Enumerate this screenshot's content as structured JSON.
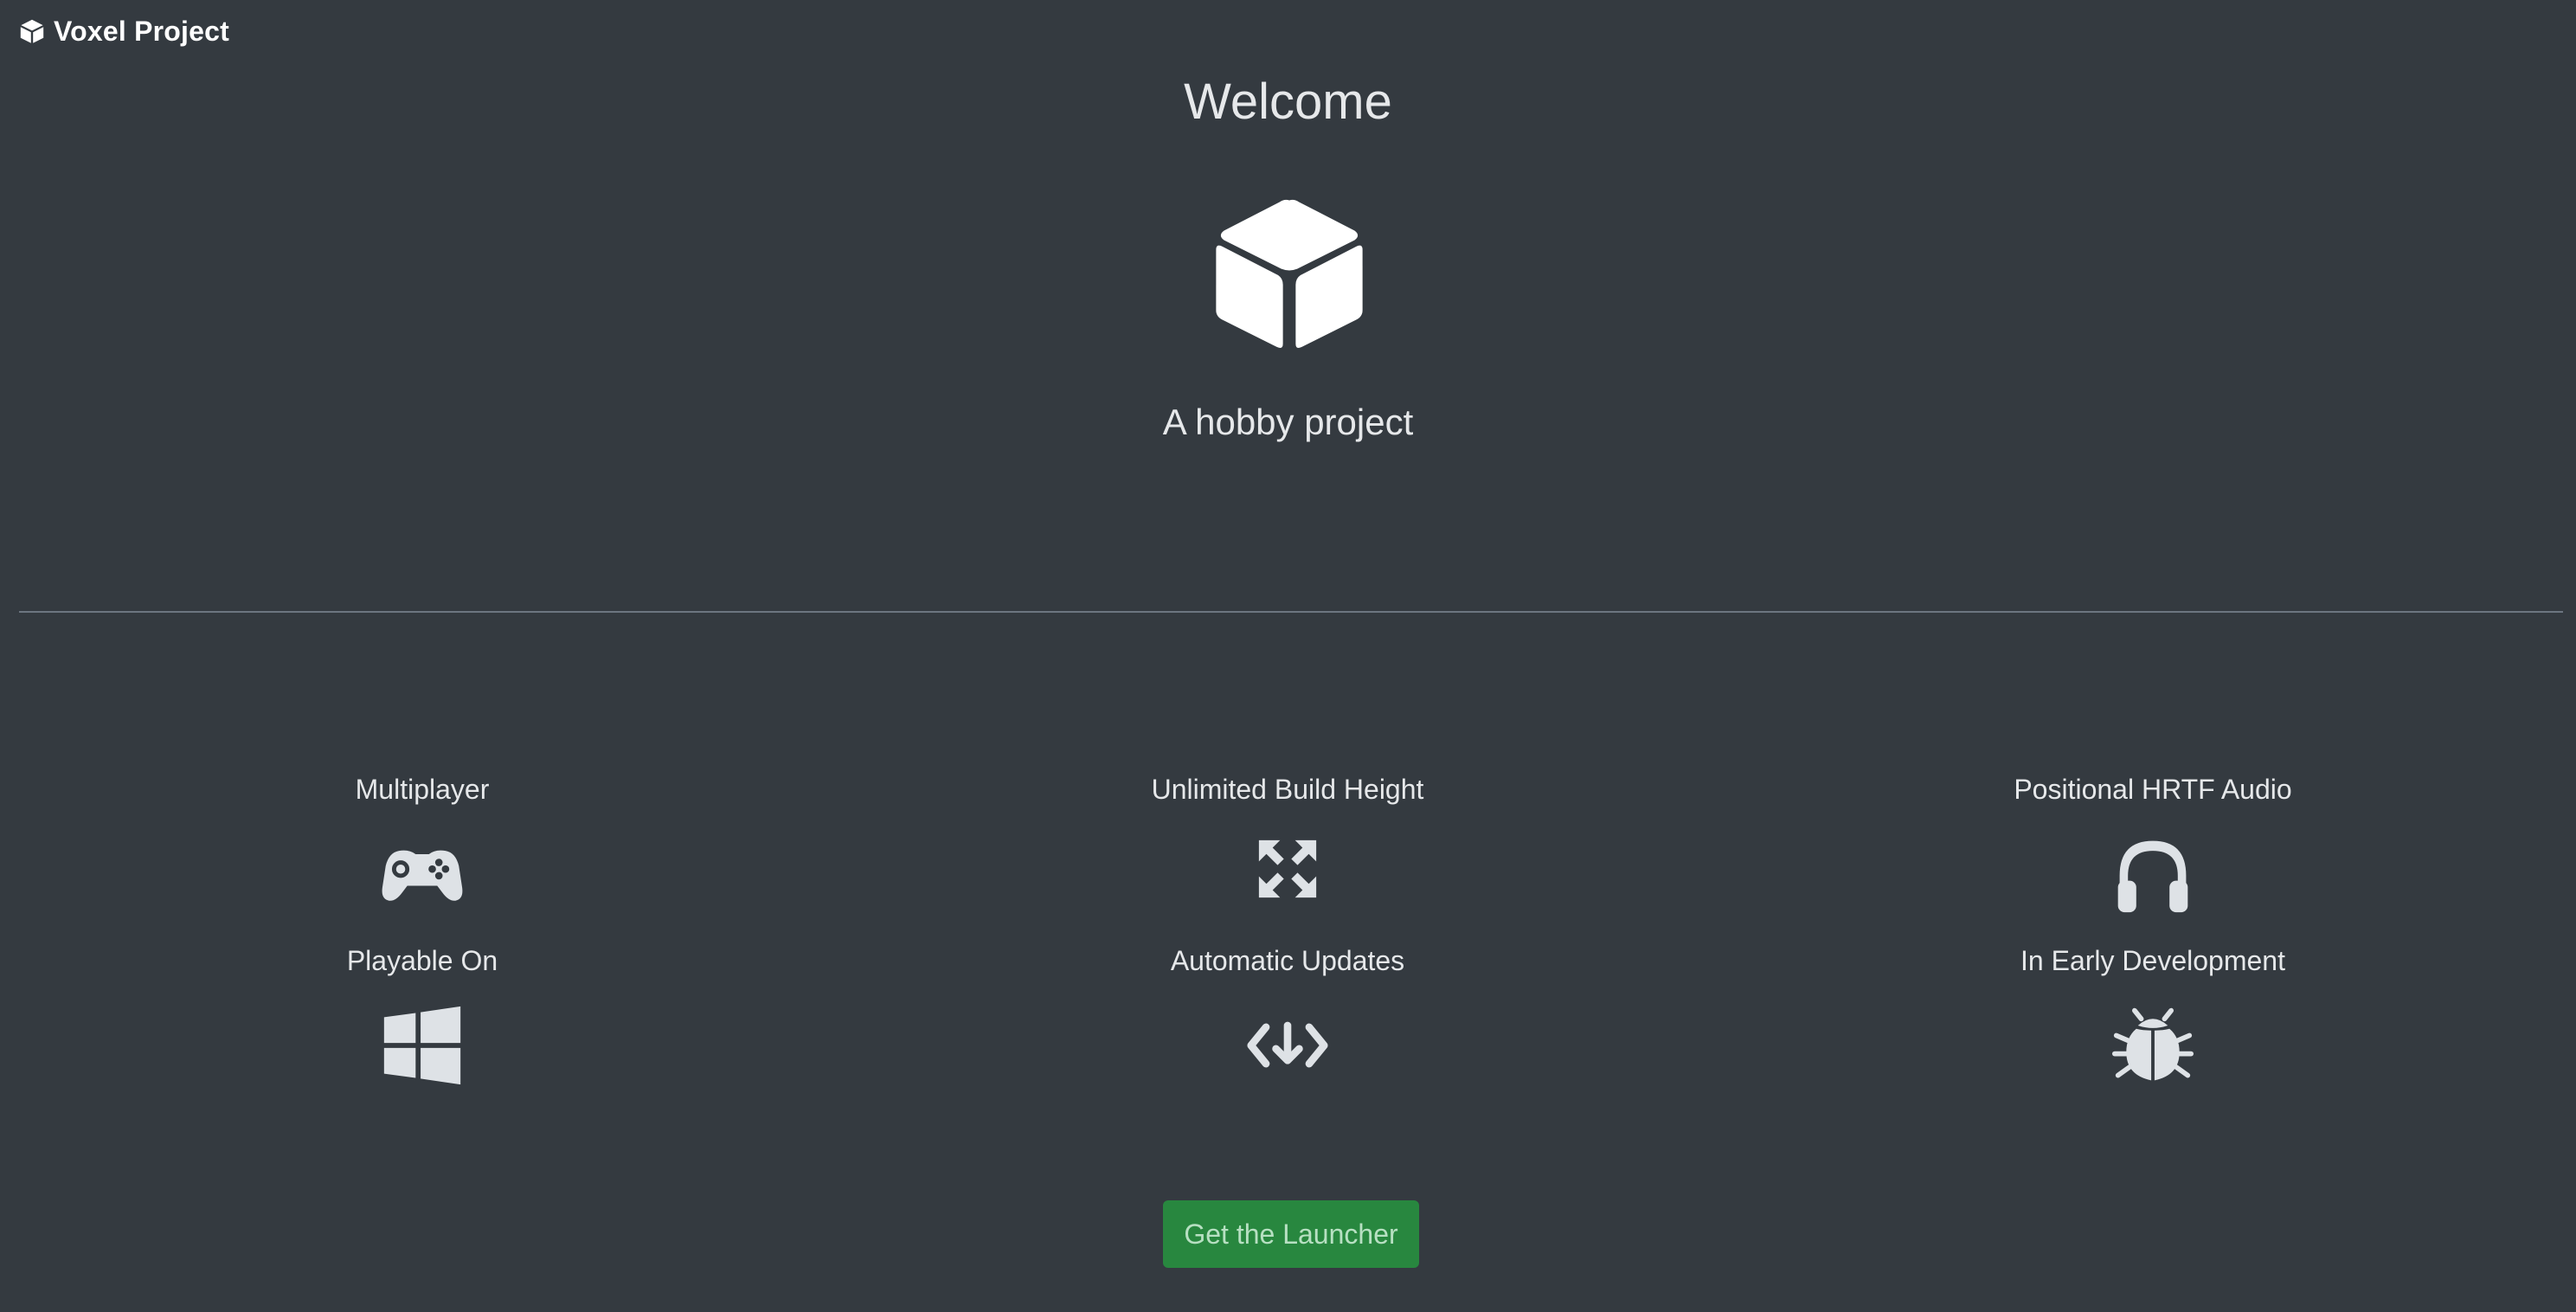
{
  "navbar": {
    "brand_label": "Voxel Project",
    "brand_icon": "cube-icon"
  },
  "hero": {
    "title": "Welcome",
    "logo_icon": "cube-icon",
    "subtitle": "A hobby project"
  },
  "features": [
    {
      "label": "Multiplayer",
      "icon": "gamepad-icon"
    },
    {
      "label": "Unlimited Build Height",
      "icon": "expand-arrows-icon"
    },
    {
      "label": "Positional HRTF Audio",
      "icon": "headphones-icon"
    },
    {
      "label": "Playable On",
      "icon": "windows-logo-icon"
    },
    {
      "label": "Automatic Updates",
      "icon": "code-download-icon"
    },
    {
      "label": "In Early Development",
      "icon": "bug-icon"
    }
  ],
  "cta": {
    "label": "Get the Launcher",
    "color": "#28873f"
  },
  "colors": {
    "background": "#343a40",
    "text": "#dee2e6",
    "divider": "#6c7580"
  }
}
